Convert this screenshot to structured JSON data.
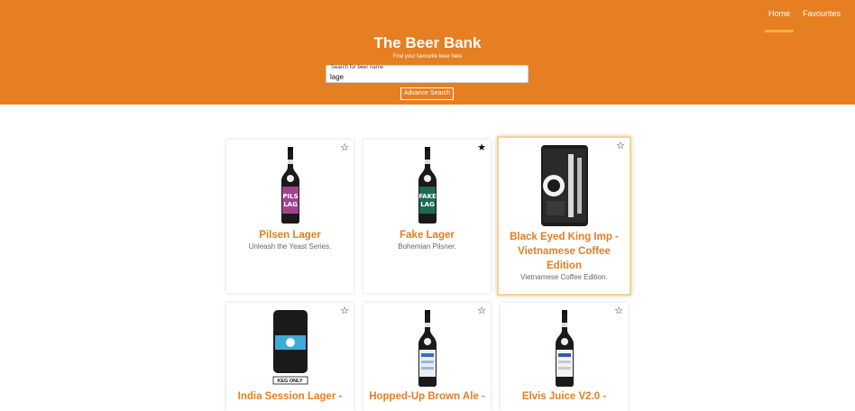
{
  "nav": {
    "home": "Home",
    "favourites": "Favourites"
  },
  "header": {
    "title": "The Beer Bank",
    "subtitle": "Find your favourite beer here",
    "search_label": "Search for beer name",
    "search_value": "lage",
    "advance_search": "Advance Search"
  },
  "colors": {
    "accent": "#e67e22",
    "highlight": "#f5b041"
  },
  "beers": [
    {
      "name": "Pilsen Lager",
      "tagline": "Unleash the Yeast Series.",
      "favourite": "☆",
      "label_color": "#a0448f"
    },
    {
      "name": "Fake Lager",
      "tagline": "Bohemian Pilsner.",
      "favourite": "★",
      "label_color": "#1d6a55"
    },
    {
      "name": "Black Eyed King Imp - Vietnamese Coffee Edition",
      "tagline": "Vietnamese Coffee Edition.",
      "favourite": "☆",
      "label_color": "#222222"
    },
    {
      "name": "India Session Lager -",
      "tagline": "",
      "favourite": "☆",
      "label_color": "#3fa9d8",
      "keg_text": "KEG ONLY"
    },
    {
      "name": "Hopped-Up Brown Ale -",
      "tagline": "",
      "favourite": "☆",
      "label_color": "#9fb7d8"
    },
    {
      "name": "Elvis Juice V2.0 -",
      "tagline": "",
      "favourite": "☆",
      "label_color": "#c9c9c9"
    }
  ]
}
